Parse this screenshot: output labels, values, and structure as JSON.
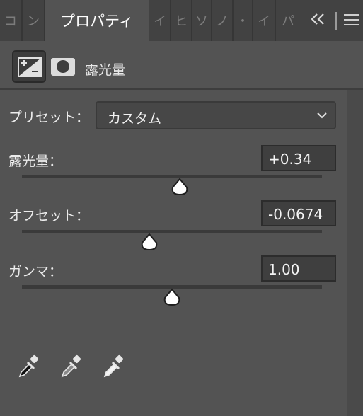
{
  "tabs": {
    "left_fragments": [
      "コ",
      "ン"
    ],
    "active_label": "プロパティ",
    "right_fragments": [
      "イ",
      "ヒ",
      "ソ",
      "ノ",
      "・",
      "イ",
      "パ"
    ],
    "collapse_glyph": "«"
  },
  "header": {
    "title": "露光量",
    "exposure_icon_text": "+/−"
  },
  "preset": {
    "label": "プリセット：",
    "value": "カスタム"
  },
  "controls": [
    {
      "label": "露光量：",
      "value": "+0.34",
      "slider_fraction": 0.525
    },
    {
      "label": "オフセット：",
      "value": "-0.0674",
      "slider_fraction": 0.425
    },
    {
      "label": "ガンマ：",
      "value": "1.00",
      "slider_fraction": 0.5
    }
  ],
  "eyedroppers": [
    "black-point",
    "gray-point",
    "white-point"
  ],
  "colors": {
    "panel_bg": "#535353",
    "tabbar_bg": "#424242",
    "field_bg": "#3f3f3f",
    "thumb_fill": "#ffffff"
  }
}
